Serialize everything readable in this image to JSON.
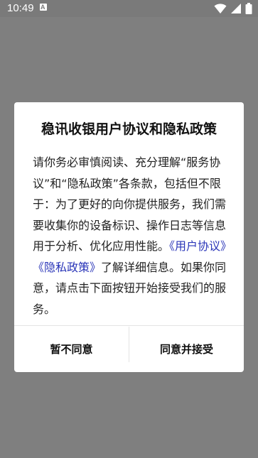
{
  "status_bar": {
    "time": "10:49",
    "notification_glyph": "A",
    "icons": [
      "wifi-icon",
      "signal-icon",
      "battery-icon"
    ]
  },
  "dialog": {
    "title": "稳讯收银用户协议和隐私政策",
    "body": {
      "before_links": "请你务必审慎阅读、充分理解“服务协议”和“隐私政策”各条款，包括但不限于：为了更好的向你提供服务，我们需要收集你的设备标识、操作日志等信息用于分析、优化应用性能。",
      "link_user_agreement": "《用户协议》",
      "link_privacy_policy": "《隐私政策》",
      "after_links": "了解详细信息。如果你同意，请点击下面按钮开始接受我们的服务。"
    },
    "decline_label": "暂不同意",
    "accept_label": "同意并接受"
  },
  "colors": {
    "overlay": "#7f7f7f",
    "link": "#2a35b8",
    "dialog_bg": "#ffffff"
  }
}
